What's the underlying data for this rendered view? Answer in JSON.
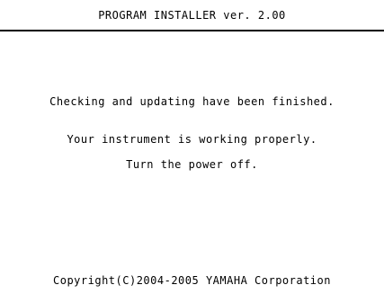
{
  "header": {
    "title": "PROGRAM INSTALLER ver. 2.00"
  },
  "main": {
    "message_finished": "Checking and updating have been finished.",
    "message_status": "Your instrument is working properly.",
    "message_instruction": "Turn the power off."
  },
  "footer": {
    "copyright": "Copyright(C)2004-2005 YAMAHA Corporation"
  }
}
